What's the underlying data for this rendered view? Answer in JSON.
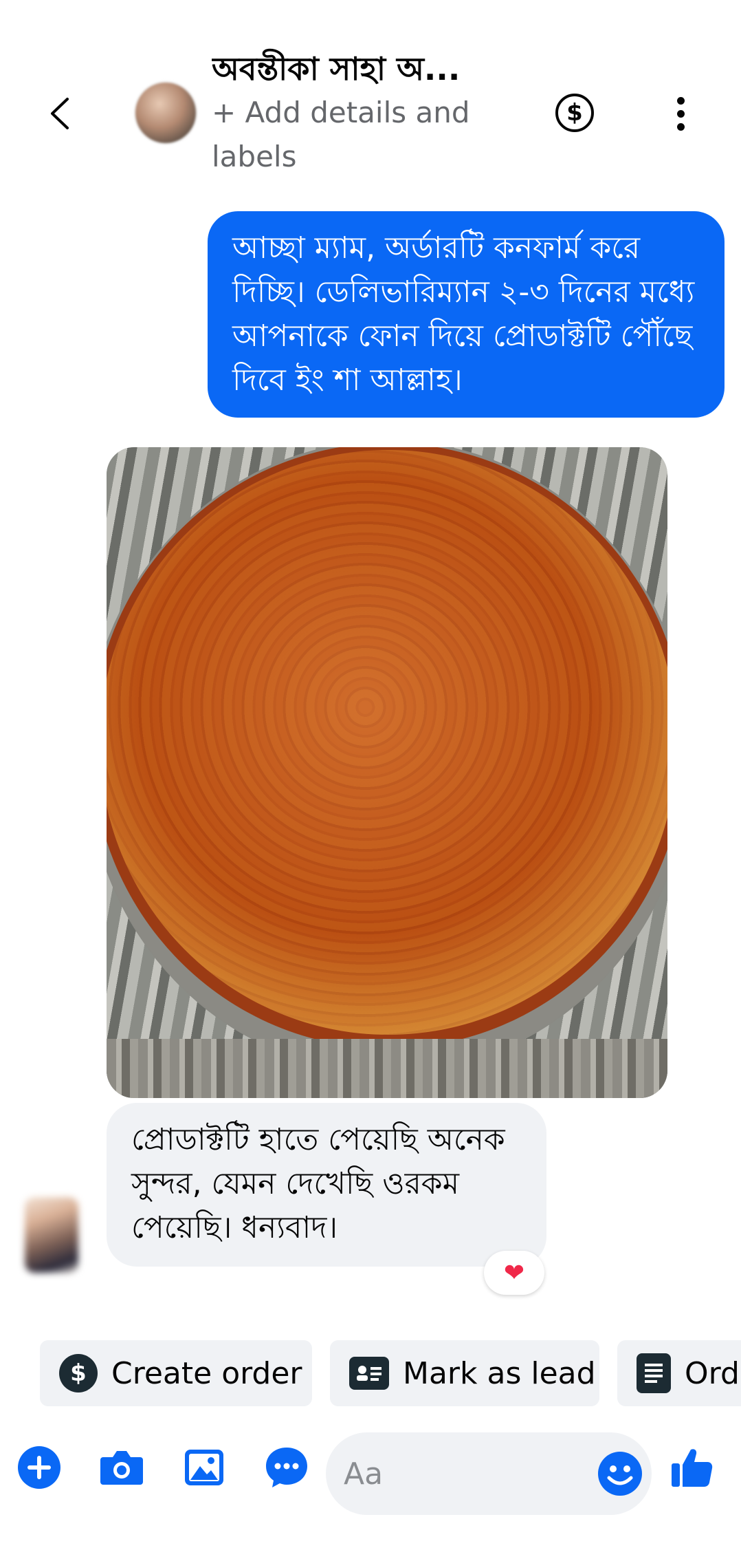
{
  "header": {
    "contact_name": "অবন্তীকা সাহা অ...",
    "subtitle": "+ Add details and labels",
    "back_icon": "chevron-left-icon",
    "payment_icon": "dollar-circle-icon",
    "more_icon": "vertical-dots-icon"
  },
  "messages": [
    {
      "direction": "outgoing",
      "text": "আচ্ছা ম্যাম, অর্ডারটি কনফার্ম করে দিচ্ছি। ডেলিভারিম্যান ২-৩ দিনের মধ্যে আপনাকে ফোন দিয়ে প্রোডাক্টটি পৌঁছে দিবে ইং শা আল্লাহ।"
    },
    {
      "direction": "incoming",
      "type": "image",
      "subject": "wood-slice-photo"
    },
    {
      "direction": "incoming",
      "text": "প্রোডাক্টটি হাতে পেয়েছি অনেক সুন্দর,  যেমন দেখেছি ওরকম পেয়েছি। ধন্যবাদ।",
      "reaction": "❤"
    }
  ],
  "quick_actions": [
    {
      "label": "Create order",
      "icon": "dollar-circle-icon"
    },
    {
      "label": "Mark as lead",
      "icon": "contact-card-icon"
    },
    {
      "label": "Ord",
      "icon": "order-list-icon"
    }
  ],
  "composer": {
    "placeholder": "Aa",
    "icons": [
      "plus-icon",
      "camera-icon",
      "gallery-icon",
      "chat-bubble-icon",
      "emoji-icon",
      "thumbs-up-icon"
    ]
  },
  "colors": {
    "accent": "#0a68f5",
    "bubble_incoming": "#f0f2f5",
    "text_secondary": "#65676b",
    "reaction": "#f02849"
  }
}
